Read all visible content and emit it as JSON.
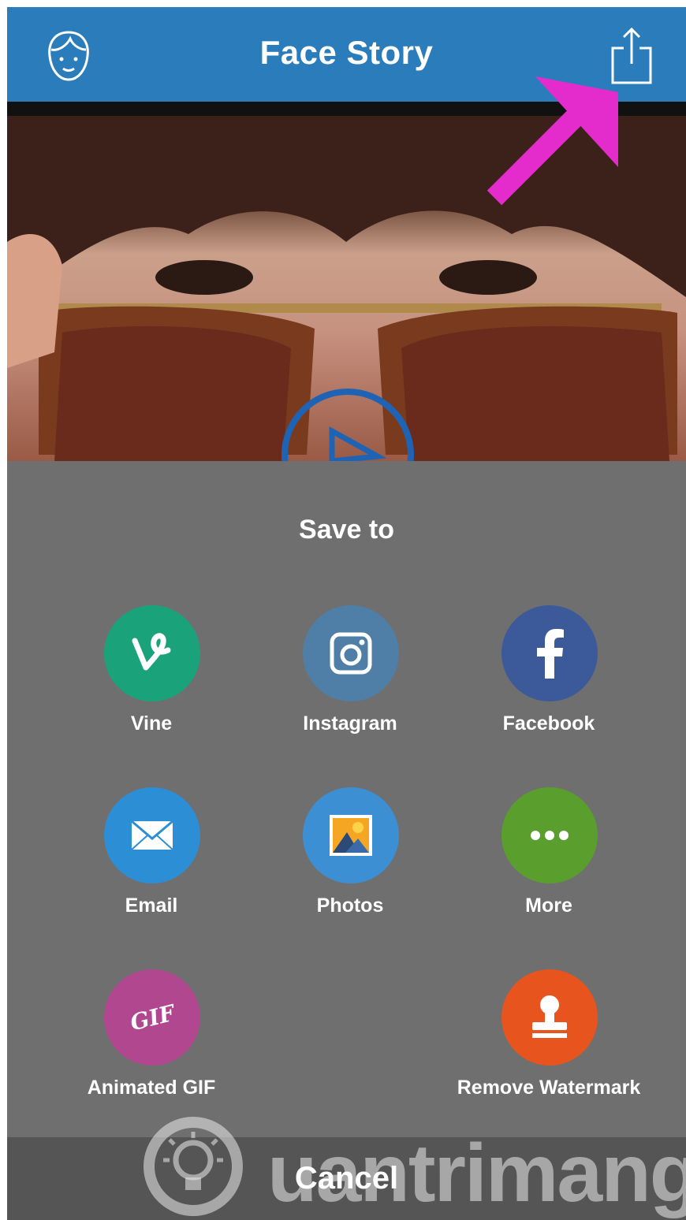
{
  "header": {
    "title": "Face Story",
    "left_icon": "face-profile-icon",
    "right_icon": "share-icon",
    "background": "#2a7dba"
  },
  "sheet": {
    "title": "Save to",
    "options": [
      {
        "label": "Vine",
        "icon": "vine-icon",
        "color": "#1aa37a"
      },
      {
        "label": "Instagram",
        "icon": "instagram-icon",
        "color": "#4f7fa6"
      },
      {
        "label": "Facebook",
        "icon": "facebook-icon",
        "color": "#3c5a9a"
      },
      {
        "label": "Email",
        "icon": "email-icon",
        "color": "#2c8fd6"
      },
      {
        "label": "Photos",
        "icon": "photos-icon",
        "color": "#3d8fd3"
      },
      {
        "label": "More",
        "icon": "more-icon",
        "color": "#5a9e2e"
      },
      {
        "label": "Animated GIF",
        "icon": "gif-icon",
        "gif_text": "GIF",
        "color": "#b0478f"
      },
      {
        "label": "Remove Watermark",
        "icon": "stamp-icon",
        "color": "#e8541e"
      }
    ]
  },
  "cancel_label": "Cancel",
  "watermark": {
    "text": "uantrimang"
  },
  "annotation": {
    "arrow_color": "#e42ccd"
  }
}
